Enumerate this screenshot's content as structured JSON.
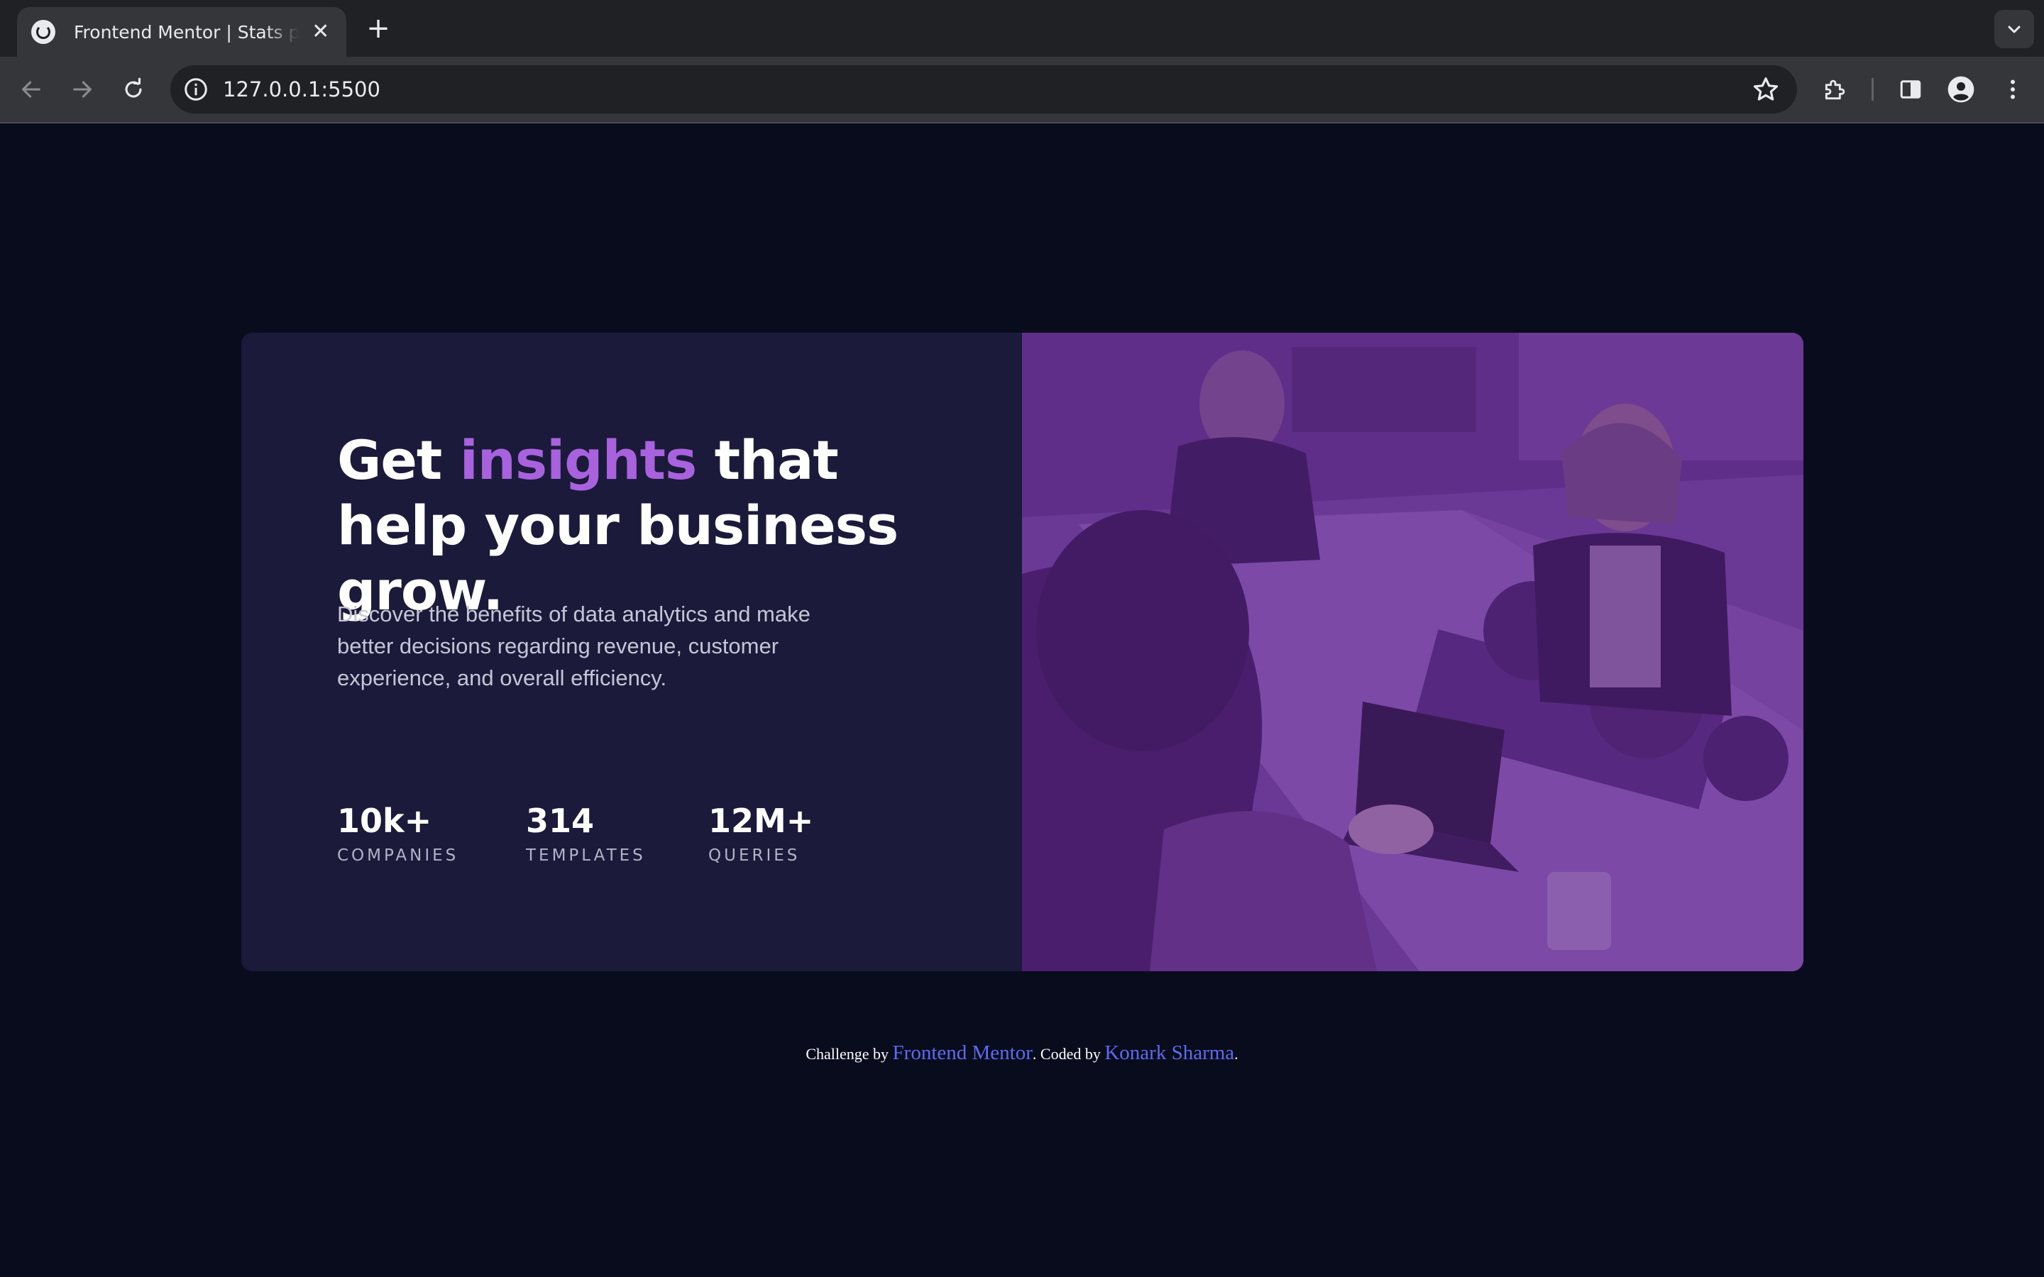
{
  "browser": {
    "tab_title": "Frontend Mentor | Stats preview card component",
    "tab_close_glyph": "✕",
    "new_tab_glyph": "+",
    "url": "127.0.0.1:5500"
  },
  "card": {
    "headline_start": "Get ",
    "headline_accent": "insights",
    "headline_end": " that help your business grow.",
    "description": "Discover the benefits of data analytics and make better decisions regarding revenue, customer experience, and overall efficiency.",
    "stats": [
      {
        "value": "10k+",
        "label": "COMPANIES"
      },
      {
        "value": "314",
        "label": "TEMPLATES"
      },
      {
        "value": "12M+",
        "label": "QUERIES"
      }
    ],
    "accent_color": "#a962de",
    "image_overlay_color": "#6a3796"
  },
  "attribution": {
    "prefix": "Challenge by ",
    "link1": "Frontend Mentor",
    "middle": ". Coded by ",
    "link2": "Konark Sharma",
    "suffix": "."
  },
  "icons": {
    "back": "arrow-left-icon",
    "forward": "arrow-right-icon",
    "reload": "reload-icon",
    "site_info": "info-icon",
    "bookmark": "star-icon",
    "extensions": "puzzle-icon",
    "side_panel": "side-panel-icon",
    "profile": "profile-icon",
    "menu": "kebab-menu-icon",
    "tab_search": "chevron-down-icon"
  }
}
